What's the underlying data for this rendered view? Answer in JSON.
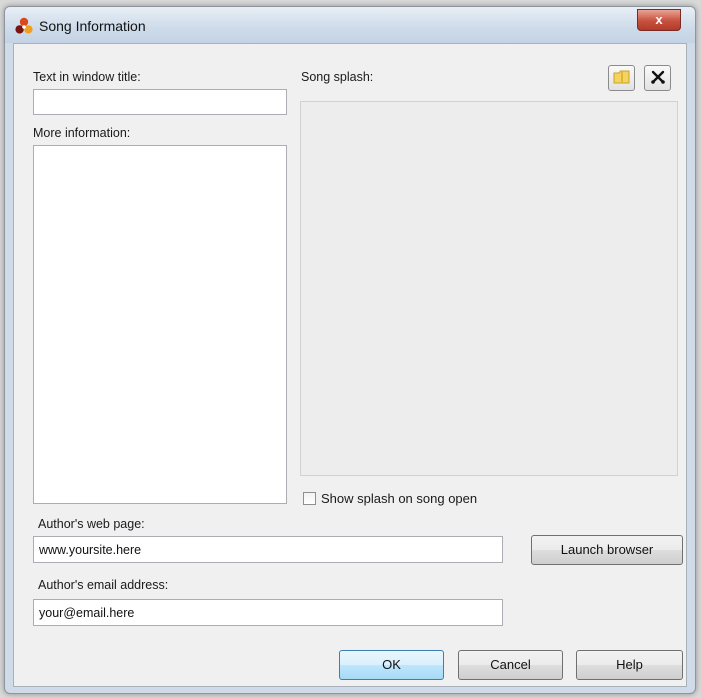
{
  "window": {
    "title": "Song Information",
    "close_glyph": "x",
    "app_icon": "tricolor-song-icon"
  },
  "left": {
    "window_title_label": "Text in window title:",
    "window_title_value": "",
    "more_info_label": "More information:",
    "more_info_value": ""
  },
  "splash": {
    "label": "Song splash:",
    "browse_icon": "folder-icon",
    "clear_icon": "scissors-icon",
    "show_on_open_label": "Show splash on song open",
    "show_on_open_checked": false
  },
  "author": {
    "web_page_label": "Author's web page:",
    "web_page_value": "www.yoursite.here",
    "launch_browser_label": "Launch browser",
    "email_label": "Author's email address:",
    "email_value": "your@email.here"
  },
  "buttons": {
    "ok": "OK",
    "cancel": "Cancel",
    "help": "Help"
  }
}
